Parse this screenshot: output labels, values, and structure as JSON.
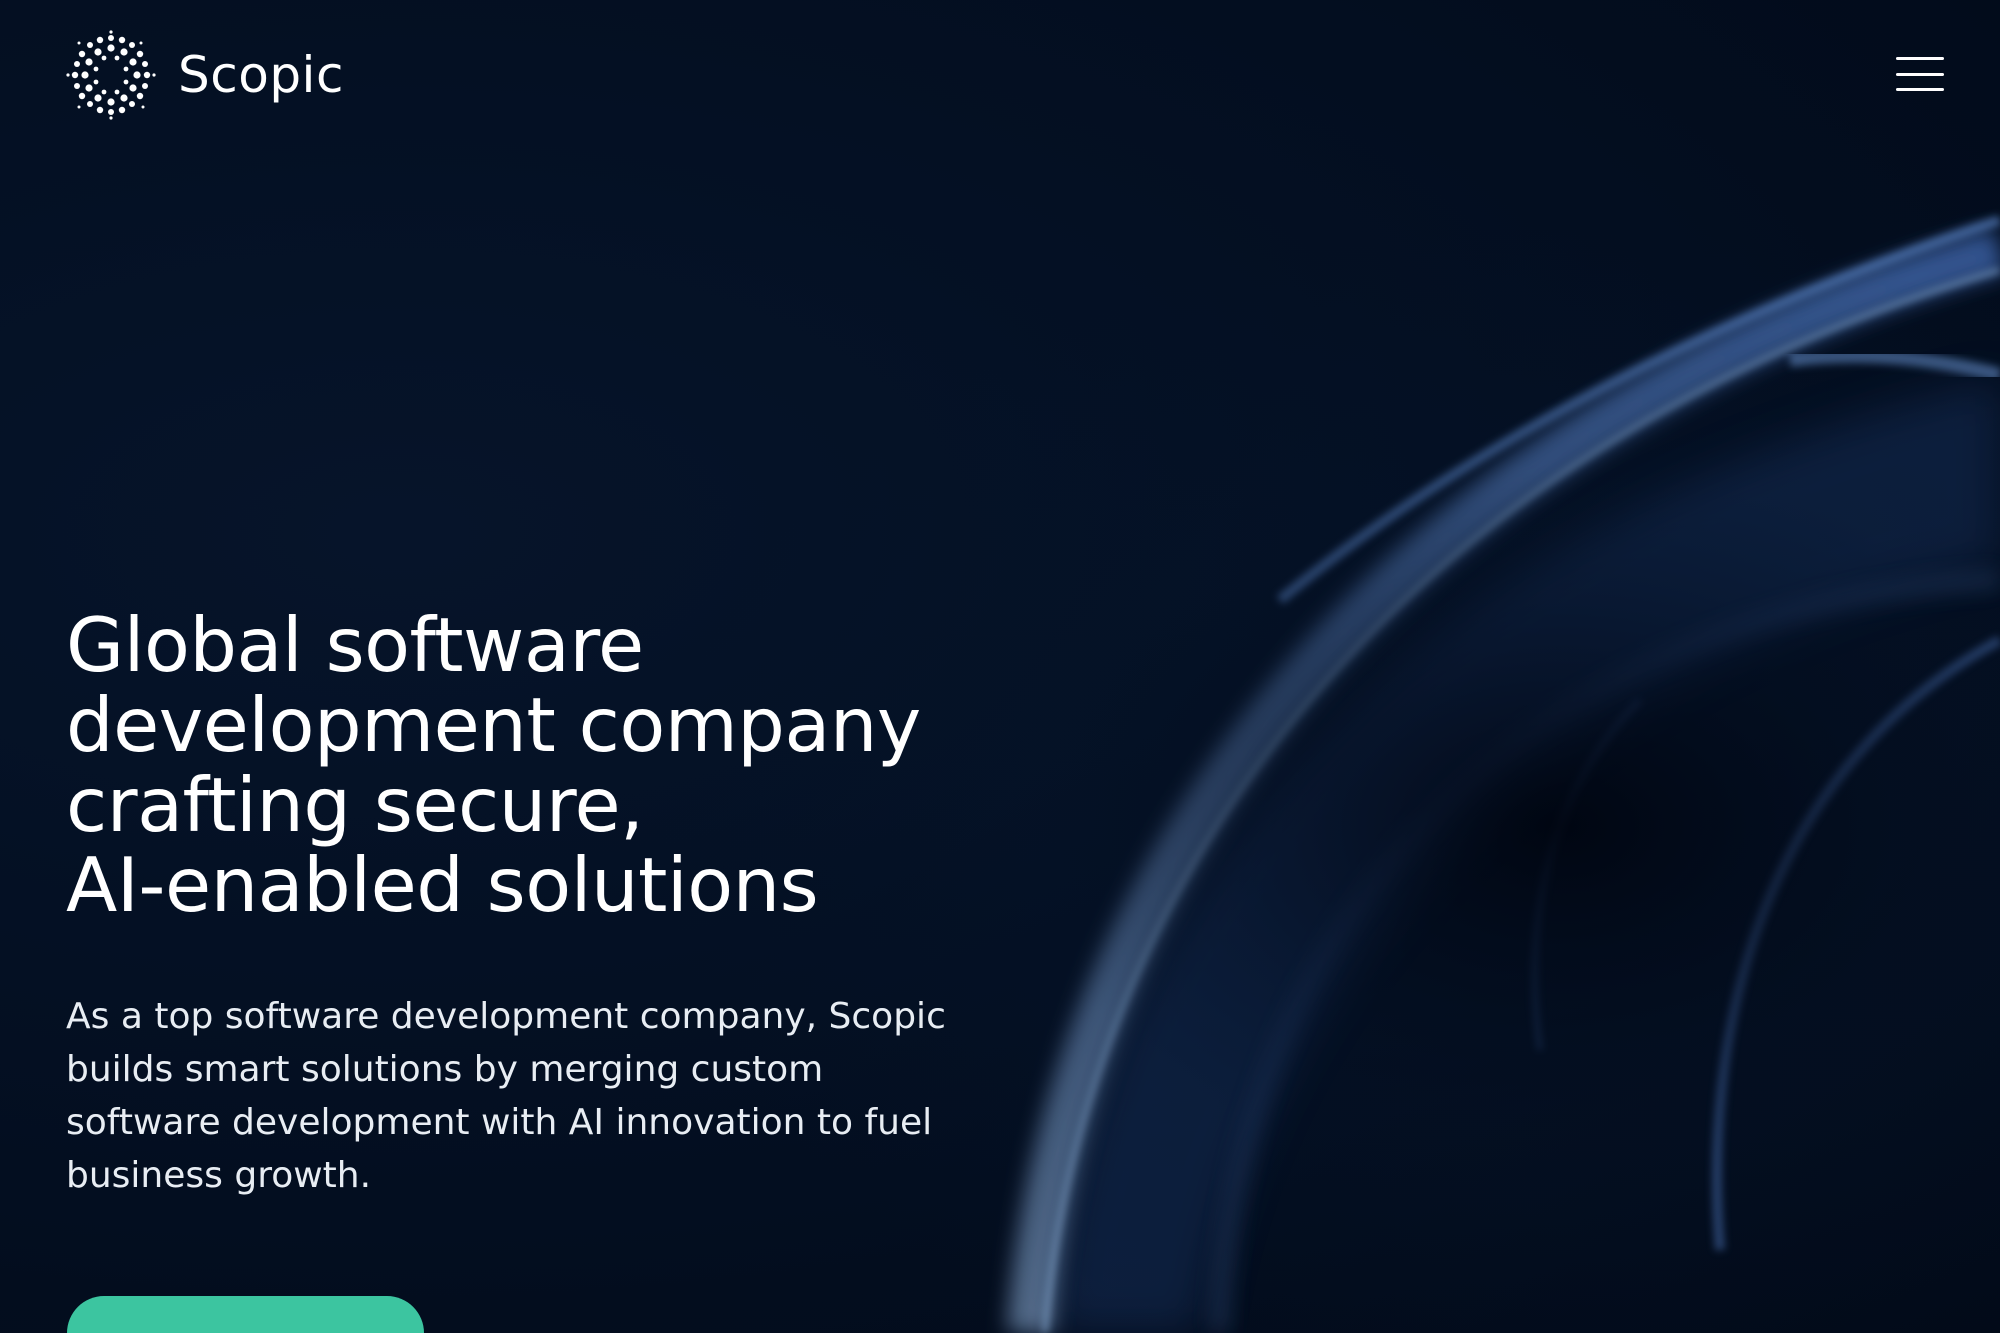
{
  "brand": {
    "name": "Scopic",
    "logo_icon": "dotted-circle-logo-icon"
  },
  "header": {
    "menu_icon": "hamburger-menu-icon"
  },
  "hero": {
    "heading_lines": [
      "Global software",
      "development company",
      "crafting secure,",
      "AI-enabled solutions"
    ],
    "description_lines": [
      "As a top software development company, Scopic",
      "builds smart solutions by merging custom",
      "software development with AI innovation to fuel",
      "business growth."
    ]
  },
  "colors": {
    "background": "#030f22",
    "accent": "#3cc5a0",
    "swirl": "#6f9bd8",
    "text": "#ffffff"
  }
}
